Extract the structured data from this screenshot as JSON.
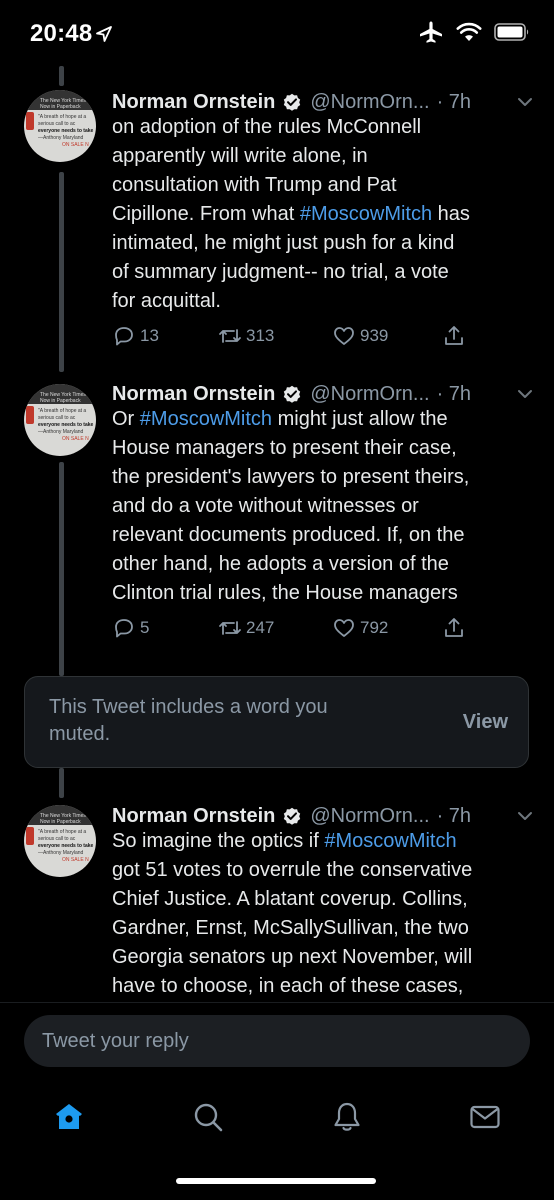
{
  "status_bar": {
    "time": "20:48",
    "icons": [
      "location-arrow-icon",
      "airplane-icon",
      "wifi-icon",
      "battery-icon"
    ]
  },
  "tweets": [
    {
      "author": "Norman Ornstein",
      "handle": "@NormOrn...",
      "time": "· 7h",
      "lines": [
        [
          {
            "t": "on adoption of the rules McConnell"
          }
        ],
        [
          {
            "t": "apparently will write alone, in"
          }
        ],
        [
          {
            "t": "consultation with Trump and Pat"
          }
        ],
        [
          {
            "t": "Cipillone. From what "
          },
          {
            "t": "#MoscowMitch",
            "tag": true
          },
          {
            "t": " has"
          }
        ],
        [
          {
            "t": "intimated, he might just push for a kind"
          }
        ],
        [
          {
            "t": "of summary judgment-- no trial, a vote"
          }
        ],
        [
          {
            "t": "for acquittal."
          }
        ]
      ],
      "replies": "13",
      "retweets": "313",
      "likes": "939"
    },
    {
      "author": "Norman Ornstein",
      "handle": "@NormOrn...",
      "time": "· 7h",
      "lines": [
        [
          {
            "t": "Or "
          },
          {
            "t": "#MoscowMitch",
            "tag": true
          },
          {
            "t": " might just allow the"
          }
        ],
        [
          {
            "t": "House managers to present their case,"
          }
        ],
        [
          {
            "t": "the president's lawyers to present theirs,"
          }
        ],
        [
          {
            "t": "and do a vote without witnesses or"
          }
        ],
        [
          {
            "t": "relevant documents produced. If, on the"
          }
        ],
        [
          {
            "t": "other hand, he adopts a version of the"
          }
        ],
        [
          {
            "t": "Clinton trial rules, the House managers"
          }
        ]
      ],
      "replies": "5",
      "retweets": "247",
      "likes": "792"
    },
    {
      "author": "Norman Ornstein",
      "handle": "@NormOrn...",
      "time": "· 7h",
      "lines": [
        [
          {
            "t": "So imagine the optics if "
          },
          {
            "t": "#MoscowMitch",
            "tag": true
          }
        ],
        [
          {
            "t": "got 51 votes to overrule the conservative"
          }
        ],
        [
          {
            "t": "Chief Justice. A blatant coverup. Collins,"
          }
        ],
        [
          {
            "t": "Gardner, Ernst, McSallySullivan, the two"
          }
        ],
        [
          {
            "t": "Georgia senators up next November, will"
          }
        ],
        [
          {
            "t": "have to choose, in each of these cases,"
          }
        ]
      ]
    }
  ],
  "avatar_cover": {
    "title": "The New York Times Now in Paperback",
    "quote": "\"A breath of hope at a serious call to ac",
    "emphasis": "everyone needs to take",
    "credit": "—Anthony Maryland",
    "sale": "ON SALE N"
  },
  "muted": {
    "text": "This Tweet includes a word you muted.",
    "action": "View"
  },
  "reply": {
    "placeholder": "Tweet your reply"
  },
  "tab_bar": {
    "tabs": [
      "home-icon",
      "search-icon",
      "notifications-bell-icon",
      "messages-envelope-icon"
    ],
    "active_color": "#1d9bf0"
  },
  "colors": {
    "background": "#000000",
    "hashtag": "#4d9ce8",
    "secondary_text": "#8b98a5"
  }
}
